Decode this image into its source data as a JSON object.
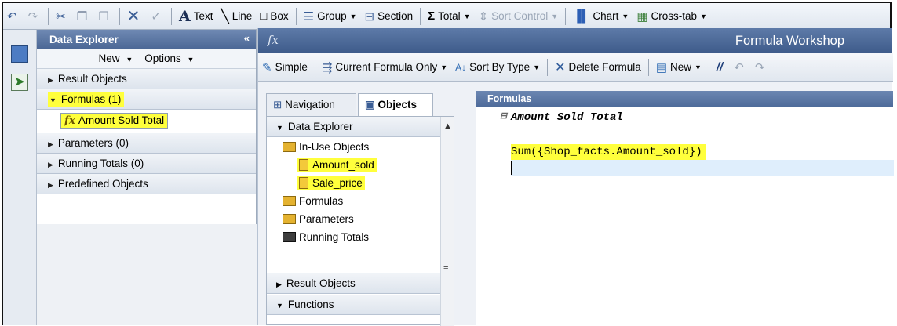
{
  "toolbar": {
    "items": [
      "Text",
      "Line",
      "Box",
      "Group",
      "Section",
      "Total",
      "Sort Control",
      "Chart",
      "Cross-tab"
    ]
  },
  "data_explorer": {
    "title": "Data Explorer",
    "new_label": "New",
    "options_label": "Options",
    "sections": {
      "result_objects": "Result Objects",
      "formulas": "Formulas (1)",
      "parameters": "Parameters (0)",
      "running_totals": "Running Totals (0)",
      "predefined_objects": "Predefined Objects"
    },
    "formula_item": "Amount Sold Total",
    "formula_icon": "fx"
  },
  "workshop": {
    "title": "Formula Workshop",
    "fx_glyph": "fx",
    "tools": {
      "simple": "Simple",
      "current_formula_only": "Current Formula Only",
      "sort_by_type": "Sort By Type",
      "delete_formula": "Delete Formula",
      "new": "New"
    },
    "tabs": {
      "navigation": "Navigation",
      "objects": "Objects"
    },
    "nav_sections": {
      "data_explorer": "Data Explorer",
      "result_objects": "Result Objects",
      "functions": "Functions"
    },
    "tree": {
      "in_use_objects": "In-Use Objects",
      "amount_sold": "Amount_sold",
      "sale_price": "Sale_price",
      "formulas": "Formulas",
      "parameters": "Parameters",
      "running_totals": "Running Totals"
    },
    "editor": {
      "header": "Formulas",
      "formula_name": "Amount Sold Total",
      "formula_text": "Sum({Shop_facts.Amount_sold})"
    }
  },
  "colors": {
    "highlight": "#ffff3c",
    "panel_header": "#4e6b9a"
  }
}
